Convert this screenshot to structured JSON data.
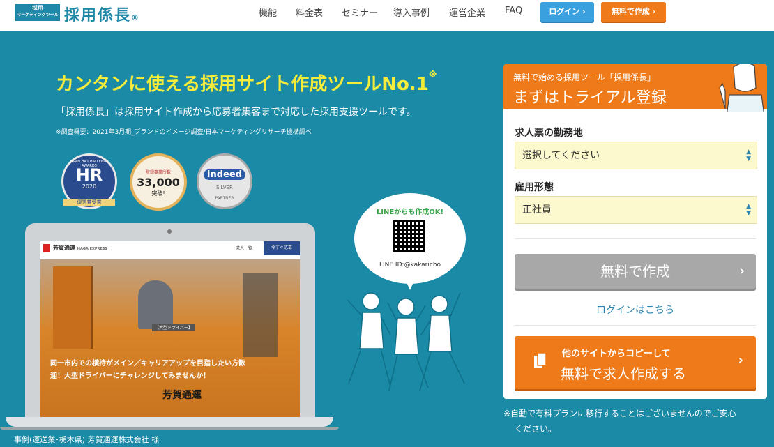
{
  "header": {
    "logo_badge_line1": "採用",
    "logo_badge_line2": "マーケティングツール",
    "logo_name": "採用係長",
    "logo_mark": "®",
    "nav": [
      "機能",
      "料金表",
      "セミナー",
      "導入事例",
      "運営企業",
      "FAQ"
    ],
    "login_label": "ログイン ›",
    "free_label": "無料で作成 ›"
  },
  "hero": {
    "title": "カンタンに使える採用サイト作成ツールNo.1",
    "title_mark": "※",
    "subtitle": "「採用係長」は採用サイト作成から応募者集客まで対応した採用支援ツールです。",
    "note": "※調査概要：2021年3月期_ブランドのイメージ調査/日本マーケティングリサーチ機構調べ"
  },
  "badges": {
    "hr_arc": "JAPAN HR CHALLENGE AWARDS",
    "hr_main": "HR",
    "hr_year": "2020",
    "hr_ribbon": "優秀賞受賞",
    "c33_top": "登録事業所数",
    "c33_main": "33,000",
    "c33_bottom": "突破!",
    "indeed_main": "indeed",
    "indeed_silver": "SILVER",
    "indeed_partner": "PARTNER"
  },
  "laptop_site": {
    "company": "芳賀通運",
    "company_sub": "HAGA EXPRESS",
    "tab_jobs": "求人一覧",
    "tab_apply": "今すぐ応募",
    "tag": "【大型ドライバー】",
    "caption1": "同一市内での横持がメイン／キャリアアップを目指したい方歓",
    "caption2": "迎！大型ドライバーにチャレンジしてみませんか！",
    "truck_text": "芳賀通運"
  },
  "case_caption": "事例(運送業･栃木県) 芳賀通運株式会社 様",
  "line_bubble": {
    "title": "LINEからも作成OK!",
    "id_label": "LINE ID:@kakaricho"
  },
  "form": {
    "kicker": "無料で始める採用ツール「採用係長」",
    "title": "まずはトライアル登録",
    "location_label": "求人票の勤務地",
    "location_value": "選択してください",
    "employment_label": "雇用形態",
    "employment_value": "正社員",
    "create_label": "無料で作成",
    "login_link": "ログインはこちら",
    "copy_small": "他のサイトからコピーして",
    "copy_big": "無料で求人作成する"
  },
  "notice": {
    "line1": "※自動で有料プランに移行することはございませんのでご安心",
    "line2": "ください。"
  },
  "colors": {
    "background": "#1a8aa6",
    "accent_orange": "#ef7a1a",
    "accent_yellow": "#f5ec3a",
    "login_blue": "#3ba0de"
  }
}
